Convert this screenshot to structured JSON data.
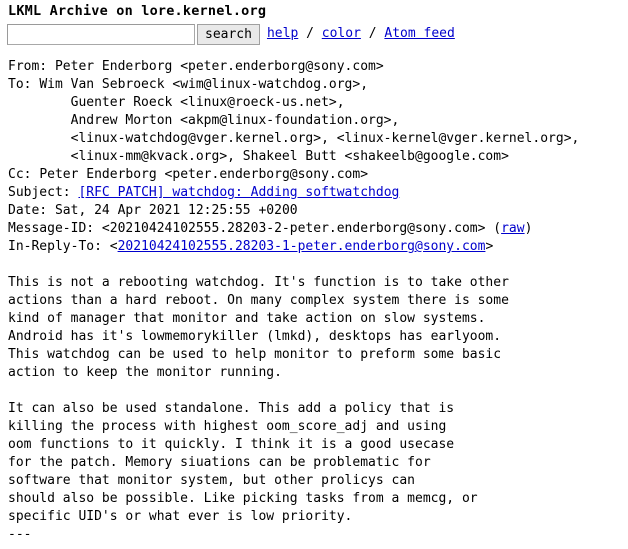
{
  "site": {
    "title": "LKML Archive on lore.kernel.org"
  },
  "search": {
    "value": "",
    "placeholder": "",
    "button_label": "search"
  },
  "nav": {
    "help_label": "help",
    "separator": " / ",
    "color_label": "color",
    "atom_label": "Atom feed"
  },
  "message": {
    "from_label": "From: ",
    "from_value": "Peter Enderborg <peter.enderborg@sony.com>",
    "to_label": "To: ",
    "to_lines": [
      "Wim Van Sebroeck <wim@linux-watchdog.org>,",
      "        Guenter Roeck <linux@roeck-us.net>,",
      "        Andrew Morton <akpm@linux-foundation.org>,",
      "        <linux-watchdog@vger.kernel.org>, <linux-kernel@vger.kernel.org>,",
      "        <linux-mm@kvack.org>, Shakeel Butt <shakeelb@google.com>"
    ],
    "cc_label": "Cc: ",
    "cc_value": "Peter Enderborg <peter.enderborg@sony.com>",
    "subject_label": "Subject: ",
    "subject_value": "[RFC PATCH] watchdog: Adding softwatchdog",
    "date_label": "Date: ",
    "date_value": "Sat, 24 Apr 2021 12:25:55 +0200",
    "message_id_label": "Message-ID: ",
    "message_id_value": "<20210424102555.28203-2-peter.enderborg@sony.com>",
    "raw_open": " (",
    "raw_label": "raw",
    "raw_close": ")",
    "in_reply_to_label": "In-Reply-To: ",
    "in_reply_to_open": "<",
    "in_reply_to_value": "20210424102555.28203-1-peter.enderborg@sony.com",
    "in_reply_to_close": ">"
  },
  "body": {
    "paragraph_1": "This is not a rebooting watchdog. It's function is to take other\nactions than a hard reboot. On many complex system there is some\nkind of manager that monitor and take action on slow systems.\nAndroid has it's lowmemorykiller (lmkd), desktops has earlyoom.\nThis watchdog can be used to help monitor to preform some basic\naction to keep the monitor running.",
    "paragraph_2": "It can also be used standalone. This add a policy that is\nkilling the process with highest oom_score_adj and using\noom functions to it quickly. I think it is a good usecase\nfor the patch. Memory siuations can be problematic for\nsoftware that monitor system, but other prolicys can\nshould also be possible. Like picking tasks from a memcg, or\nspecific UID's or what ever is low priority.",
    "signature_separator": "---"
  },
  "colors": {
    "link": "#0000cc",
    "text": "#000000",
    "background": "#ffffff",
    "button_face": "#e9e9e9",
    "input_border": "#a8a8a8"
  }
}
